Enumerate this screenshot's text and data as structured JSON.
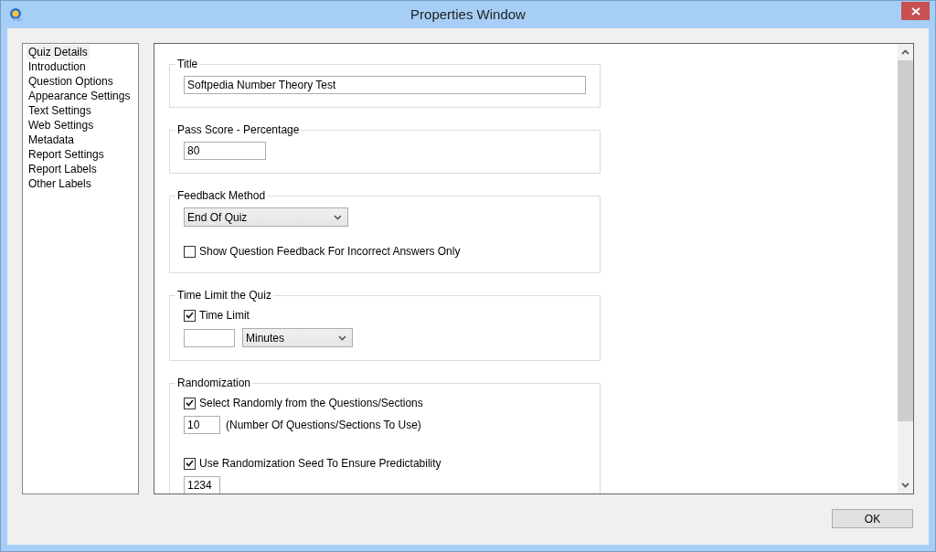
{
  "window": {
    "title": "Properties Window"
  },
  "sidebar": {
    "items": [
      {
        "label": "Quiz Details",
        "selected": true
      },
      {
        "label": "Introduction",
        "selected": false
      },
      {
        "label": "Question Options",
        "selected": false
      },
      {
        "label": "Appearance Settings",
        "selected": false
      },
      {
        "label": "Text Settings",
        "selected": false
      },
      {
        "label": "Web Settings",
        "selected": false
      },
      {
        "label": "Metadata",
        "selected": false
      },
      {
        "label": "Report Settings",
        "selected": false
      },
      {
        "label": "Report Labels",
        "selected": false
      },
      {
        "label": "Other Labels",
        "selected": false
      }
    ]
  },
  "groups": [
    {
      "title": "Title",
      "items": [
        {
          "kind": "text",
          "value": "Softpedia Number Theory Test"
        }
      ]
    },
    {
      "title": "Pass Score - Percentage",
      "items": [
        {
          "kind": "score",
          "value": "80"
        }
      ]
    },
    {
      "title": "Feedback Method",
      "items": [
        {
          "kind": "dropdown",
          "value": "End Of Quiz"
        },
        {
          "kind": "checkbox",
          "label": "Show Question Feedback For Incorrect Answers Only",
          "checked": false
        }
      ]
    },
    {
      "title": "Time Limit the Quiz",
      "items": [
        {
          "kind": "checkbox",
          "label": "Time Limit",
          "checked": true
        },
        {
          "kind": "field-dropdown",
          "unit": "Minutes"
        }
      ]
    },
    {
      "title": "Randomization",
      "items": [
        {
          "kind": "checkbox",
          "label": "Select Randomly from the Questions/Sections",
          "checked": true
        },
        {
          "kind": "count",
          "value": "10",
          "note": "(Number Of Questions/Sections To Use)"
        },
        {
          "kind": "checkbox",
          "label": "Use Randomization Seed To Ensure Predictability",
          "checked": true
        },
        {
          "kind": "count",
          "value": "1234"
        }
      ]
    }
  ],
  "buttons": [
    "OK"
  ]
}
